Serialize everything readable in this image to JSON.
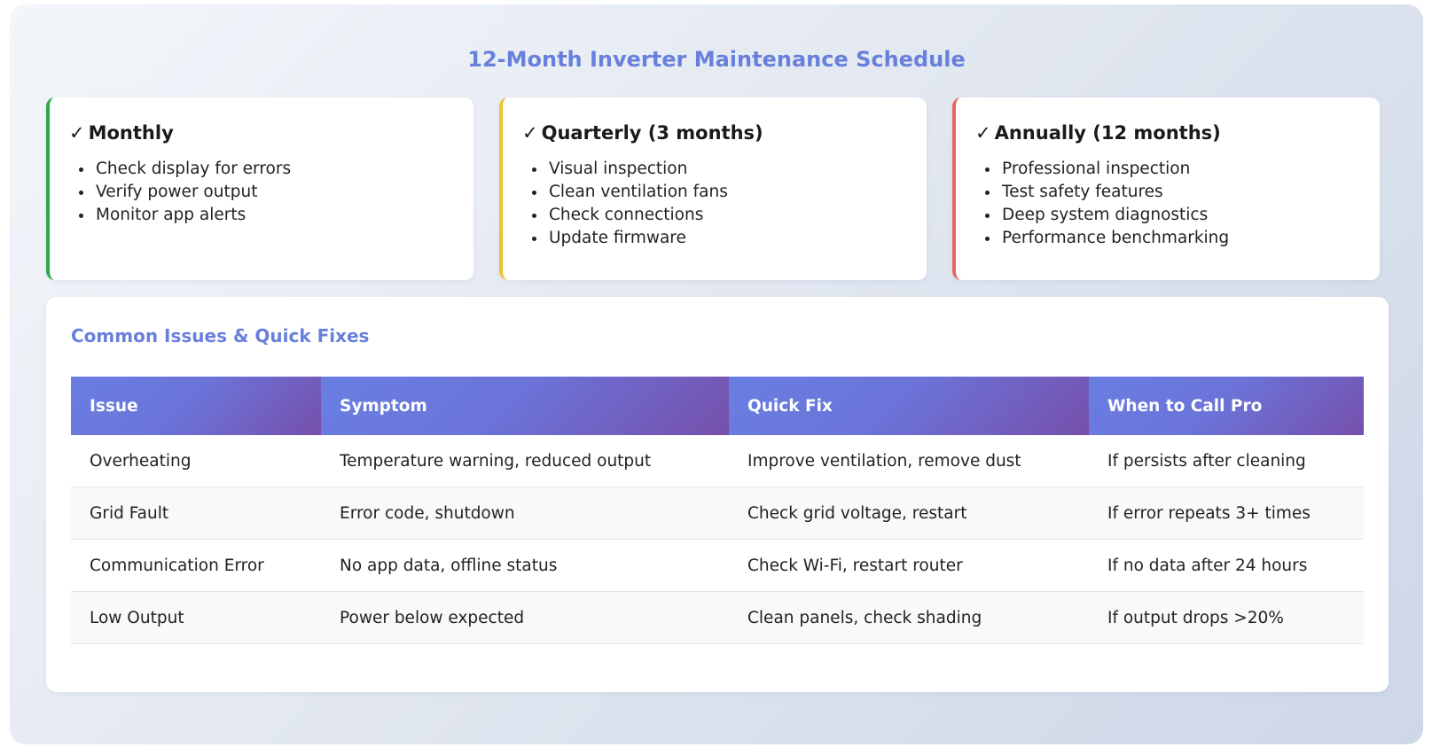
{
  "page": {
    "title": "12-Month Inverter Maintenance Schedule"
  },
  "schedule": [
    {
      "check": "✓",
      "title": "Monthly",
      "accent": "#2ea84a",
      "items": [
        "Check display for errors",
        "Verify power output",
        "Monitor app alerts"
      ]
    },
    {
      "check": "✓",
      "title": "Quarterly (3 months)",
      "accent": "#f2c12e",
      "items": [
        "Visual inspection",
        "Clean ventilation fans",
        "Check connections",
        "Update firmware"
      ]
    },
    {
      "check": "✓",
      "title": "Annually (12 months)",
      "accent": "#ea6565",
      "items": [
        "Professional inspection",
        "Test safety features",
        "Deep system diagnostics",
        "Performance benchmarking"
      ]
    }
  ],
  "issues_table": {
    "title": "Common Issues & Quick Fixes",
    "headers": [
      "Issue",
      "Symptom",
      "Quick Fix",
      "When to Call Pro"
    ],
    "rows": [
      [
        "Overheating",
        "Temperature warning, reduced output",
        "Improve ventilation, remove dust",
        "If persists after cleaning"
      ],
      [
        "Grid Fault",
        "Error code, shutdown",
        "Check grid voltage, restart",
        "If error repeats 3+ times"
      ],
      [
        "Communication Error",
        "No app data, offline status",
        "Check Wi-Fi, restart router",
        "If no data after 24 hours"
      ],
      [
        "Low Output",
        "Power below expected",
        "Clean panels, check shading",
        "If output drops >20%"
      ]
    ]
  },
  "colors": {
    "title_accent": "#6880dc",
    "header_gradient_start": "#6a7ee2",
    "header_gradient_end": "#7650ab"
  }
}
